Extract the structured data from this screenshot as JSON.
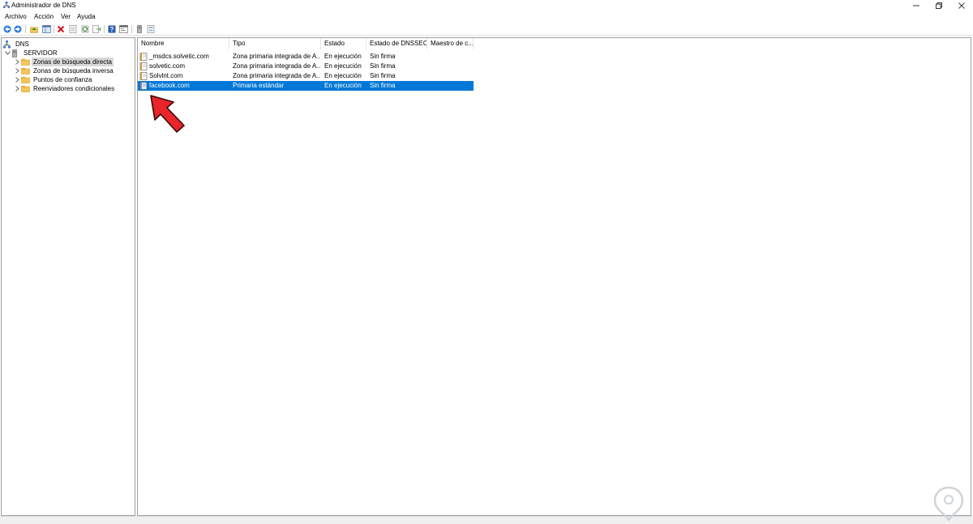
{
  "window": {
    "title": "Administrador de DNS"
  },
  "menu": {
    "items": [
      "Archivo",
      "Acción",
      "Ver",
      "Ayuda"
    ]
  },
  "toolbar": {
    "buttons": [
      "back-icon",
      "forward-icon",
      "up-icon",
      "show-hide-tree-icon",
      "delete-icon",
      "properties-icon",
      "refresh-icon",
      "export-icon",
      "help-icon",
      "console-icon",
      "server-icon",
      "list-icon"
    ]
  },
  "tree": {
    "root": "DNS",
    "server": "SERVIDOR",
    "children": [
      "Zonas de búsqueda directa",
      "Zonas de búsqueda inversa",
      "Puntos de confianza",
      "Reenviadores condicionales"
    ],
    "selected_index": 0
  },
  "list": {
    "columns": [
      "Nombre",
      "Tipo",
      "Estado",
      "Estado de DNSSEC",
      "Maestro de c..."
    ],
    "rows": [
      {
        "name": "_msdcs.solvetic.com",
        "type": "Zona primaria integrada de A...",
        "status": "En ejecución",
        "dnssec": "Sin firma",
        "master": ""
      },
      {
        "name": "solvetic.com",
        "type": "Zona primaria integrada de A...",
        "status": "En ejecución",
        "dnssec": "Sin firma",
        "master": ""
      },
      {
        "name": "Solvlnt.com",
        "type": "Zona primaria integrada de A...",
        "status": "En ejecución",
        "dnssec": "Sin firma",
        "master": ""
      },
      {
        "name": "facebook.com",
        "type": "Primaria estándar",
        "status": "En ejecución",
        "dnssec": "Sin firma",
        "master": ""
      }
    ],
    "selected_row": 3
  },
  "colors": {
    "selection": "#0078d7",
    "annotation_arrow": "#e8252a",
    "tree_selection": "#d9d9d9"
  }
}
